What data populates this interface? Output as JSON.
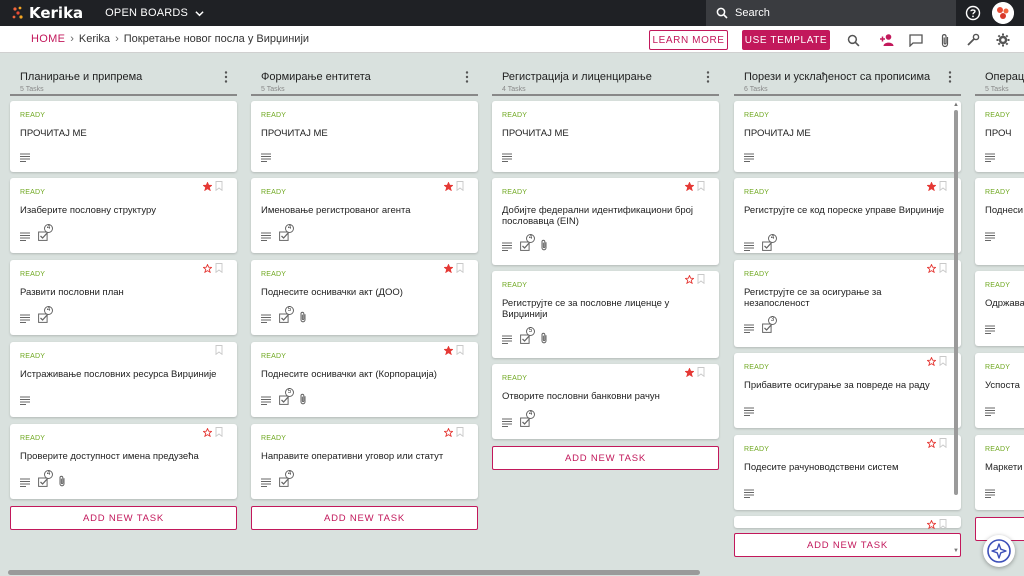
{
  "app": {
    "name": "Kerika",
    "boards_menu": "OPEN BOARDS"
  },
  "search": {
    "placeholder": "Search"
  },
  "breadcrumb": {
    "home": "HOME",
    "level1": "Kerika",
    "level2": "Покретање новог посла у Вирџинији"
  },
  "actions": {
    "learn_more": "LEARN MORE",
    "use_template": "USE TEMPLATE"
  },
  "icons": {
    "logo": "kerika-logo-icon",
    "boards_dropdown": "chevron-down-icon",
    "search": "search-icon",
    "help": "help-icon",
    "avatar": "avatar",
    "toolbar_search": "search-icon",
    "add_person": "add-person-icon",
    "chat": "chat-icon",
    "attachment": "paperclip-icon",
    "tools": "wrench-icon",
    "settings": "gear-icon",
    "description": "description-icon",
    "checklist": "checklist-icon",
    "star": "star-icon",
    "bookmark": "bookmark-icon",
    "column_menu": "kebab-menu-icon",
    "assistant": "sparkle-icon"
  },
  "colors": {
    "accent": "#c2185b",
    "ready": "#6fa820",
    "star": "#e53935",
    "topbar": "#1f2125",
    "board_bg": "#d9e1de"
  },
  "add_task_label": "ADD NEW TASK",
  "columns": [
    {
      "title": "Планирање и припрема",
      "count": "5 Tasks",
      "cards": [
        {
          "status": "READY",
          "title": "ПРОЧИТАЈ МЕ",
          "star": "none",
          "checklist": "",
          "attachment": false
        },
        {
          "status": "READY",
          "title": "Изаберите пословну структуру",
          "star": "filled",
          "checklist": "4",
          "attachment": false
        },
        {
          "status": "READY",
          "title": "Развити пословни план",
          "star": "outline",
          "checklist": "4",
          "attachment": false
        },
        {
          "status": "READY",
          "title": "Истраживање пословних ресурса Вирџиније",
          "star": "bookmark-only",
          "checklist": "",
          "attachment": false
        },
        {
          "status": "READY",
          "title": "Проверите доступност имена предузећа",
          "star": "outline",
          "checklist": "4",
          "attachment": true
        }
      ]
    },
    {
      "title": "Формирање ентитета",
      "count": "5 Tasks",
      "cards": [
        {
          "status": "READY",
          "title": "ПРОЧИТАЈ МЕ",
          "star": "none",
          "checklist": "",
          "attachment": false
        },
        {
          "status": "READY",
          "title": "Именовање регистрованог агента",
          "star": "filled",
          "checklist": "4",
          "attachment": false
        },
        {
          "status": "READY",
          "title": "Поднесите оснивачки акт (ДОО)",
          "star": "filled",
          "checklist": "5",
          "attachment": true
        },
        {
          "status": "READY",
          "title": "Поднесите оснивачки акт (Корпорација)",
          "star": "filled",
          "checklist": "5",
          "attachment": true
        },
        {
          "status": "READY",
          "title": "Направите оперативни уговор или статут",
          "star": "outline",
          "checklist": "4",
          "attachment": false
        }
      ]
    },
    {
      "title": "Регистрација и лиценцирање",
      "count": "4 Tasks",
      "cards": [
        {
          "status": "READY",
          "title": "ПРОЧИТАЈ МЕ",
          "star": "none",
          "checklist": "",
          "attachment": false
        },
        {
          "status": "READY",
          "title": "Добијте федерални идентификациони број пословавца (EIN)",
          "star": "filled",
          "checklist": "4",
          "attachment": true
        },
        {
          "status": "READY",
          "title": "Региструјте се за пословне лиценце у Вирџинији",
          "star": "outline",
          "checklist": "5",
          "attachment": true
        },
        {
          "status": "READY",
          "title": "Отворите пословни банковни рачун",
          "star": "filled",
          "checklist": "4",
          "attachment": false
        }
      ]
    },
    {
      "title": "Порези и усклађеност са прописима",
      "count": "6 Tasks",
      "cards": [
        {
          "status": "READY",
          "title": "ПРОЧИТАЈ МЕ",
          "star": "none",
          "checklist": "",
          "attachment": false
        },
        {
          "status": "READY",
          "title": "Региструјте се код пореске управе Вирџиније",
          "star": "filled",
          "checklist": "4",
          "attachment": false
        },
        {
          "status": "READY",
          "title": "Региструјте се за осигурање за незапосленост",
          "star": "outline",
          "checklist": "3",
          "attachment": false
        },
        {
          "status": "READY",
          "title": "Прибавите осигурање за повреде на раду",
          "star": "outline",
          "checklist": "",
          "attachment": false
        },
        {
          "status": "READY",
          "title": "Подесите рачуноводствени систем",
          "star": "outline",
          "checklist": "",
          "attachment": false
        },
        {
          "status": "",
          "title": "",
          "star": "outline",
          "checklist": "",
          "attachment": false
        }
      ]
    },
    {
      "title": "Операц",
      "count": "5 Tasks",
      "cards": [
        {
          "status": "READY",
          "title": "ПРОЧ",
          "star": "none",
          "checklist": "",
          "attachment": false
        },
        {
          "status": "READY",
          "title": "Поднеси тргови",
          "star": "none",
          "checklist": "",
          "attachment": false
        },
        {
          "status": "READY",
          "title": "Одржава",
          "star": "none",
          "checklist": "",
          "attachment": false
        },
        {
          "status": "READY",
          "title": "Успоста",
          "star": "none",
          "checklist": "",
          "attachment": false
        },
        {
          "status": "READY",
          "title": "Маркети",
          "star": "none",
          "checklist": "",
          "attachment": false
        }
      ]
    }
  ]
}
